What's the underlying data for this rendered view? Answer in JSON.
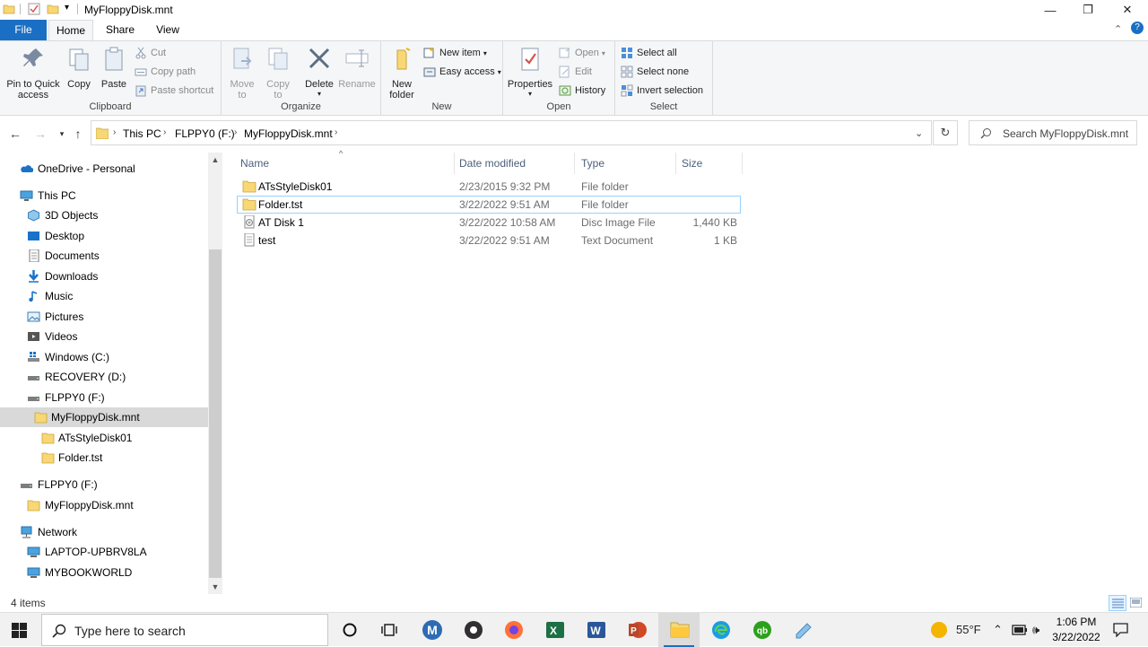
{
  "window": {
    "title": "MyFloppyDisk.mnt",
    "controls": {
      "minimize": "—",
      "maximize": "❐",
      "close": "✕"
    }
  },
  "tabs": {
    "file": "File",
    "home": "Home",
    "share": "Share",
    "view": "View"
  },
  "ribbon": {
    "clipboard": {
      "label": "Clipboard",
      "pin": "Pin to Quick access",
      "pin_l1": "Pin to Quick",
      "pin_l2": "access",
      "copy": "Copy",
      "paste": "Paste",
      "cut": "Cut",
      "copy_path": "Copy path",
      "paste_shortcut": "Paste shortcut"
    },
    "organize": {
      "label": "Organize",
      "move_l1": "Move",
      "move_l2": "to",
      "copy_l1": "Copy",
      "copy_l2": "to",
      "delete": "Delete",
      "rename": "Rename"
    },
    "new": {
      "label": "New",
      "new_folder_l1": "New",
      "new_folder_l2": "folder",
      "new_item": "New item",
      "easy_access": "Easy access"
    },
    "open": {
      "label": "Open",
      "properties": "Properties",
      "open": "Open",
      "edit": "Edit",
      "history": "History"
    },
    "select": {
      "label": "Select",
      "select_all": "Select all",
      "select_none": "Select none",
      "invert": "Invert selection"
    }
  },
  "address": {
    "crumbs": [
      "This PC",
      "FLPPY0 (F:)",
      "MyFloppyDisk.mnt"
    ],
    "search_placeholder": "Search MyFloppyDisk.mnt"
  },
  "nav": {
    "onedrive": "OneDrive - Personal",
    "thispc": "This PC",
    "objects3d": "3D Objects",
    "desktop": "Desktop",
    "documents": "Documents",
    "downloads": "Downloads",
    "music": "Music",
    "pictures": "Pictures",
    "videos": "Videos",
    "windows": "Windows (C:)",
    "recovery": "RECOVERY (D:)",
    "flppy0": "FLPPY0 (F:)",
    "myfloppy": "MyFloppyDisk.mnt",
    "atsstyle": "ATsStyleDisk01",
    "foldertst": "Folder.tst",
    "flppy0_b": "FLPPY0 (F:)",
    "myfloppy_b": "MyFloppyDisk.mnt",
    "network": "Network",
    "laptop": "LAPTOP-UPBRV8LA",
    "mybook": "MYBOOKWORLD"
  },
  "columns": {
    "name": "Name",
    "date": "Date modified",
    "type": "Type",
    "size": "Size"
  },
  "files": [
    {
      "name": "ATsStyleDisk01",
      "date": "2/23/2015 9:32 PM",
      "type": "File folder",
      "size": "",
      "icon": "folder-icon"
    },
    {
      "name": "Folder.tst",
      "date": "3/22/2022 9:51 AM",
      "type": "File folder",
      "size": "",
      "icon": "folder-icon"
    },
    {
      "name": "AT Disk 1",
      "date": "3/22/2022 10:58 AM",
      "type": "Disc Image File",
      "size": "1,440 KB",
      "icon": "disc-image-icon"
    },
    {
      "name": "test",
      "date": "3/22/2022 9:51 AM",
      "type": "Text Document",
      "size": "1 KB",
      "icon": "text-file-icon"
    }
  ],
  "status": {
    "count": "4 items"
  },
  "taskbar": {
    "search_placeholder": "Type here to search",
    "weather": "55°F",
    "time": "1:06 PM",
    "date": "3/22/2022"
  },
  "colors": {
    "accent": "#1a6fc4",
    "folder": "#f8d775",
    "selection": "#d9d9d9"
  }
}
